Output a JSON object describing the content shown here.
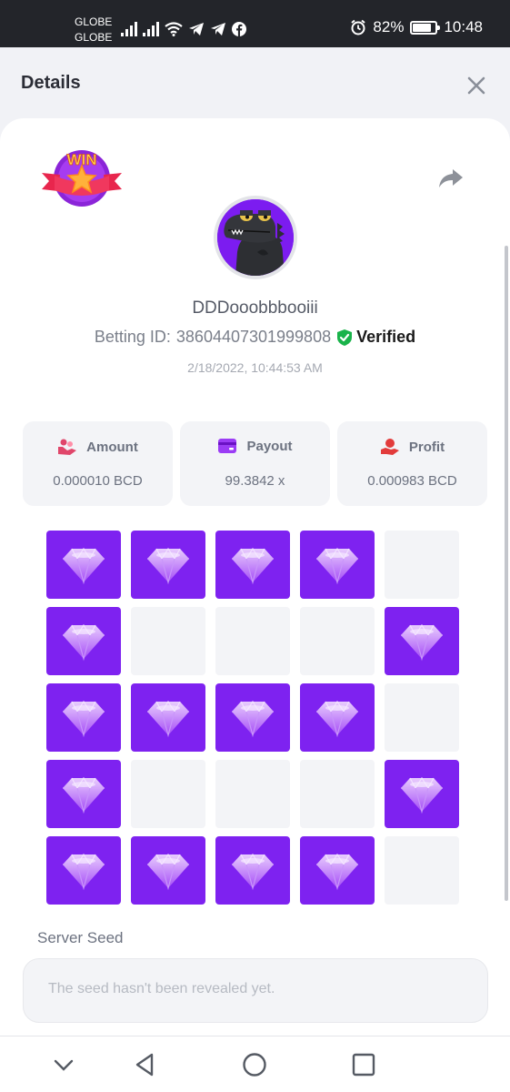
{
  "status_bar": {
    "carrier_1": "GLOBE",
    "carrier_2": "GLOBE",
    "battery_percent": "82%",
    "battery_level": 0.82,
    "time": "10:48",
    "icons": [
      "signal-icon",
      "signal-icon",
      "wifi-icon",
      "telegram-icon",
      "telegram-icon",
      "facebook-icon",
      "alarm-icon",
      "battery-icon"
    ]
  },
  "header": {
    "title": "Details",
    "close_icon": "close-icon"
  },
  "bet": {
    "badge_text": "WIN",
    "username": "DDDooobbbooiii",
    "betting_id_label": "Betting ID:",
    "betting_id": "38604407301999808",
    "verified_label": "Verified",
    "timestamp": "2/18/2022, 10:44:53 AM"
  },
  "stats": [
    {
      "label": "Amount",
      "value": "0.000010 BCD",
      "icon": "coins-icon"
    },
    {
      "label": "Payout",
      "value": "99.3842 x",
      "icon": "card-icon"
    },
    {
      "label": "Profit",
      "value": "0.000983 BCD",
      "icon": "hand-coin-icon"
    }
  ],
  "grid": [
    [
      true,
      true,
      true,
      true,
      false
    ],
    [
      true,
      false,
      false,
      false,
      true
    ],
    [
      true,
      true,
      true,
      true,
      false
    ],
    [
      true,
      false,
      false,
      false,
      true
    ],
    [
      true,
      true,
      true,
      true,
      false
    ]
  ],
  "seed": {
    "label": "Server Seed",
    "placeholder": "The seed hasn't been revealed yet."
  },
  "colors": {
    "accent": "#7e22f0",
    "verified": "#19b34a",
    "status_bar": "#23252a"
  },
  "nav": {
    "icons": [
      "chevron-down-icon",
      "back-icon",
      "home-icon",
      "recents-icon"
    ]
  }
}
